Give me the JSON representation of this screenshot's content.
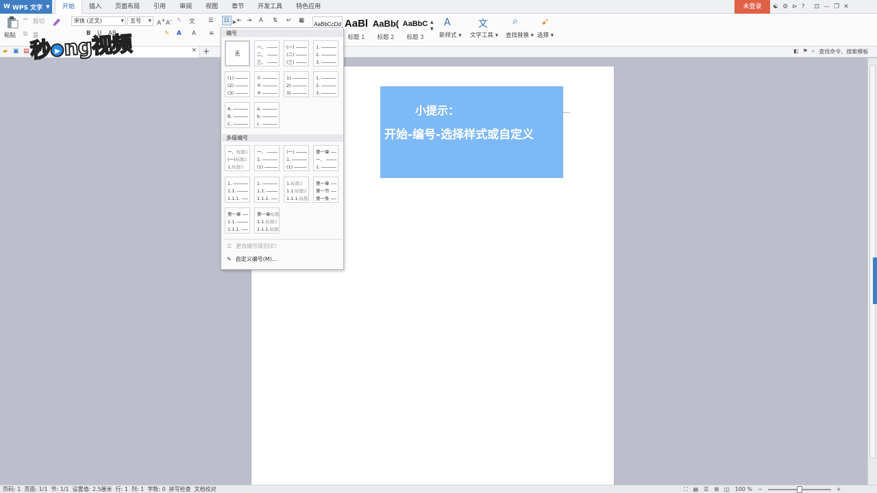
{
  "app": {
    "name": "WPS 文字",
    "logo": "W"
  },
  "menu_tabs": [
    "开始",
    "插入",
    "页面布局",
    "引用",
    "审阅",
    "视图",
    "章节",
    "开发工具",
    "特色应用"
  ],
  "active_tab": "开始",
  "login_label": "未登录",
  "ribbon": {
    "paste": "粘贴",
    "cut": "剪切",
    "copy": "复",
    "font_name": "宋体 (正文)",
    "font_size": "五号",
    "styles": [
      {
        "sample": "AaBbCcDd",
        "label": ""
      },
      {
        "sample": "AaBl",
        "label": "标题 1"
      },
      {
        "sample": "AaBb(",
        "label": "标题 2"
      },
      {
        "sample": "AaBbC",
        "label": "标题 3"
      }
    ],
    "new_style": "新样式",
    "text_tools": "文字工具",
    "find_replace": "查找替换",
    "select": "选择"
  },
  "quickbar": {
    "right": [
      "查找命令、搜索模板"
    ]
  },
  "dropdown": {
    "section_numbering": "编号",
    "section_multilevel": "多级编号",
    "none_label": "无",
    "single": [
      [
        "一、",
        "二、",
        "三、"
      ],
      [
        "(一)",
        "(二)",
        "(三)"
      ],
      [
        "1.",
        "2.",
        "3."
      ],
      [
        "(1)",
        "(2)",
        "(3)"
      ],
      [
        "①",
        "②",
        "③"
      ],
      [
        "1)",
        "2)",
        "3)"
      ],
      [
        "1.",
        "2.",
        "3."
      ],
      [
        "A.",
        "B.",
        "C."
      ],
      [
        "a.",
        "b.",
        "c."
      ]
    ],
    "multi": [
      [
        [
          "一、",
          "标题1"
        ],
        [
          "(一)",
          "标题2"
        ],
        [
          "1.",
          "标题3"
        ]
      ],
      [
        [
          "一、",
          ""
        ],
        [
          "1.",
          ""
        ],
        [
          "(1)",
          ""
        ]
      ],
      [
        [
          "(一)",
          ""
        ],
        [
          "1.",
          ""
        ],
        [
          "(1)",
          ""
        ]
      ],
      [
        [
          "第一章",
          ""
        ],
        [
          "一、",
          ""
        ],
        [
          "1.",
          ""
        ]
      ],
      [
        [
          "1.",
          ""
        ],
        [
          "1.1.",
          ""
        ],
        [
          "1.1.1.",
          ""
        ]
      ],
      [
        [
          "1.",
          ""
        ],
        [
          "1.1.",
          ""
        ],
        [
          "1.1.1.",
          ""
        ]
      ],
      [
        [
          "1.",
          "标题1"
        ],
        [
          "1.1.",
          "标题2"
        ],
        [
          "1.1.1.",
          "标题3"
        ]
      ],
      [
        [
          "第一章",
          ""
        ],
        [
          "第一节",
          ""
        ],
        [
          "第一条",
          ""
        ]
      ],
      [
        [
          "第一章",
          ""
        ],
        [
          "1.1.",
          ""
        ],
        [
          "1.1.1.",
          ""
        ]
      ],
      [
        [
          "第一章",
          "标题1"
        ],
        [
          "1.1.",
          "标题2"
        ],
        [
          "1.1.1.",
          "标题3"
        ]
      ]
    ],
    "change_level": "更改编号级别(E)",
    "custom": "自定义编号(M)..."
  },
  "tip": {
    "title": "小提示：",
    "text": "开始-编号-选择样式或自定义"
  },
  "watermark": "秒dong视频",
  "status": {
    "items": [
      "页码: 1",
      "页面: 1/1",
      "节: 1/1",
      "设置值: 2.5厘米",
      "行: 1",
      "列: 1",
      "字数: 0",
      "拼写检查",
      "文档校对"
    ],
    "zoom": "100 %"
  }
}
